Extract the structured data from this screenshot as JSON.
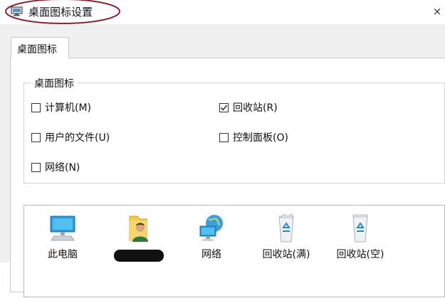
{
  "window": {
    "title": "桌面图标设置",
    "close_glyph": "×",
    "icon": "desktop-settings-icon"
  },
  "tabs": [
    {
      "label": "桌面图标",
      "selected": true
    }
  ],
  "group": {
    "label": "桌面图标",
    "checkboxes": [
      {
        "label": "计算机(M)",
        "checked": false
      },
      {
        "label": "回收站(R)",
        "checked": true
      },
      {
        "label": "用户的文件(U)",
        "checked": false
      },
      {
        "label": "控制面板(O)",
        "checked": false
      },
      {
        "label": "网络(N)",
        "checked": false
      }
    ]
  },
  "icon_list": [
    {
      "caption": "此电脑",
      "icon": "computer-icon"
    },
    {
      "caption": "",
      "icon": "user-files-icon",
      "redacted": true
    },
    {
      "caption": "网络",
      "icon": "network-icon"
    },
    {
      "caption": "回收站(满)",
      "icon": "recycle-bin-full-icon"
    },
    {
      "caption": "回收站(空)",
      "icon": "recycle-bin-empty-icon"
    }
  ],
  "colors": {
    "annotation_oval": "#8b2432",
    "dialog_background": "#f0f0f0",
    "panel_background": "#ffffff",
    "border": "#c8c8c8"
  }
}
